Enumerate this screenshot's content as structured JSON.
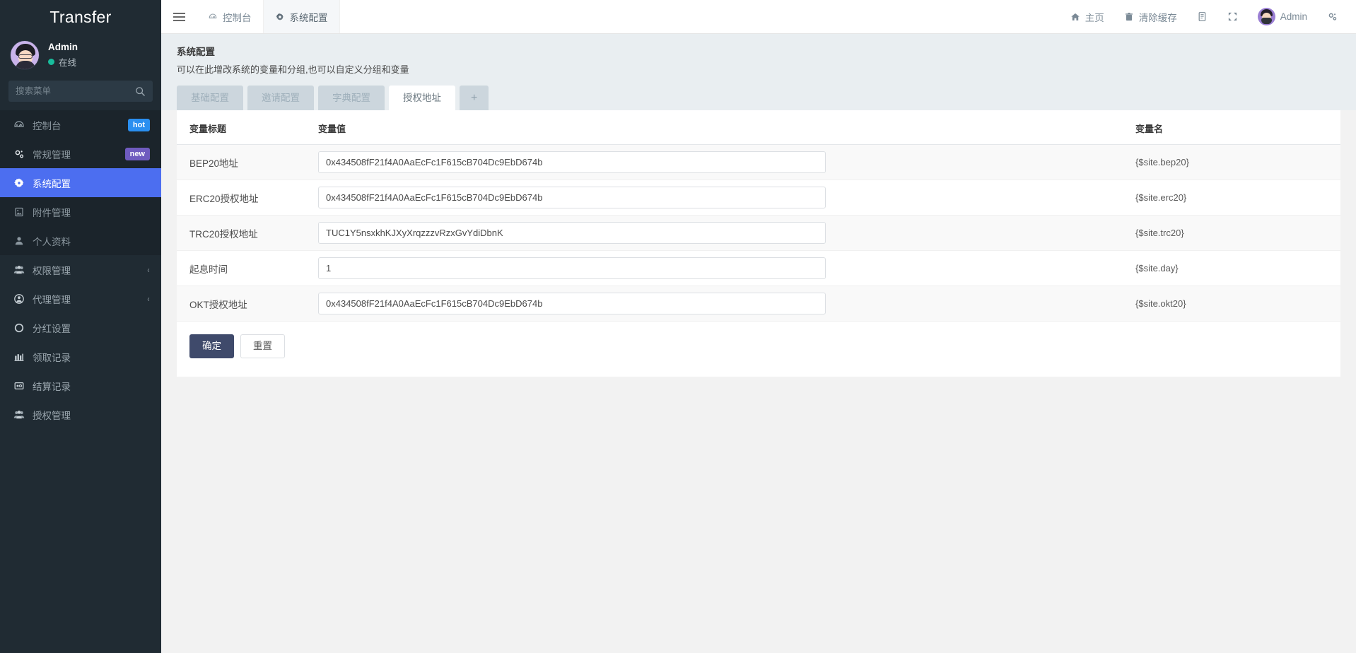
{
  "sidebar": {
    "brand": "Transfer",
    "user": {
      "name": "Admin",
      "status": "在线"
    },
    "search": {
      "placeholder": "搜索菜单",
      "value": ""
    },
    "items": [
      {
        "label": "控制台",
        "icon": "dashboard-icon",
        "badge": "hot",
        "badge_type": "hot",
        "state": "dim"
      },
      {
        "label": "常规管理",
        "icon": "cogs-icon",
        "badge": "new",
        "badge_type": "new",
        "state": "dim"
      },
      {
        "label": "系统配置",
        "icon": "gear-icon",
        "badge": "",
        "badge_type": "",
        "state": "active"
      },
      {
        "label": "附件管理",
        "icon": "image-file-icon",
        "badge": "",
        "badge_type": "",
        "state": "dim"
      },
      {
        "label": "个人资料",
        "icon": "user-icon",
        "badge": "",
        "badge_type": "",
        "state": "dim"
      },
      {
        "label": "权限管理",
        "icon": "users-group-icon",
        "badge": "",
        "badge_type": "",
        "state": "normal",
        "chevron": "‹"
      },
      {
        "label": "代理管理",
        "icon": "user-circle-icon",
        "badge": "",
        "badge_type": "",
        "state": "normal",
        "chevron": "‹"
      },
      {
        "label": "分红设置",
        "icon": "circle-icon",
        "badge": "",
        "badge_type": "",
        "state": "normal"
      },
      {
        "label": "领取记录",
        "icon": "chart-icon",
        "badge": "",
        "badge_type": "",
        "state": "normal"
      },
      {
        "label": "结算记录",
        "icon": "card-icon",
        "badge": "",
        "badge_type": "",
        "state": "normal"
      },
      {
        "label": "授权管理",
        "icon": "users-group-icon",
        "badge": "",
        "badge_type": "",
        "state": "normal"
      }
    ]
  },
  "topbar": {
    "menu_toggle": "menu-icon",
    "tabs": [
      {
        "label": "控制台",
        "icon": "dashboard-icon",
        "selected": false
      },
      {
        "label": "系统配置",
        "icon": "gear-icon",
        "selected": true
      }
    ],
    "right_items": [
      {
        "label": "主页",
        "icon": "home-icon"
      },
      {
        "label": "清除缓存",
        "icon": "trash-icon"
      },
      {
        "label": "",
        "icon": "note-icon"
      },
      {
        "label": "",
        "icon": "fullscreen-icon"
      },
      {
        "label": "Admin",
        "icon": "avatar"
      },
      {
        "label": "",
        "icon": "settings-gear-icon"
      }
    ]
  },
  "panel": {
    "title": "系统配置",
    "subtitle": "可以在此增改系统的变量和分组,也可以自定义分组和变量",
    "tabs": [
      {
        "label": "基础配置",
        "active": false
      },
      {
        "label": "邀请配置",
        "active": false
      },
      {
        "label": "字典配置",
        "active": false
      },
      {
        "label": "授权地址",
        "active": true
      },
      {
        "label": "+",
        "active": false,
        "is_add": true
      }
    ]
  },
  "table": {
    "headers": {
      "title": "变量标题",
      "value": "变量值",
      "name": "变量名"
    },
    "rows": [
      {
        "title": "BEP20地址",
        "value": "0x434508fF21f4A0AaEcFc1F615cB704Dc9EbD674b",
        "name": "{$site.bep20}"
      },
      {
        "title": "ERC20授权地址",
        "value": "0x434508fF21f4A0AaEcFc1F615cB704Dc9EbD674b",
        "name": "{$site.erc20}"
      },
      {
        "title": "TRC20授权地址",
        "value": "TUC1Y5nsxkhKJXyXrqzzzvRzxGvYdiDbnK",
        "name": "{$site.trc20}"
      },
      {
        "title": "起息时间",
        "value": "1",
        "name": "{$site.day}"
      },
      {
        "title": "OKT授权地址",
        "value": "0x434508fF21f4A0AaEcFc1F615cB704Dc9EbD674b",
        "name": "{$site.okt20}"
      }
    ]
  },
  "actions": {
    "submit": "确定",
    "reset": "重置"
  },
  "colors": {
    "sidebar_bg": "#202b33",
    "active_menu": "#4c6ef0",
    "badge_hot": "#2a8ff0",
    "badge_new": "#6f5bbf",
    "primary_button": "#3f4a6b",
    "panel_bg": "#e9eef1",
    "online_dot": "#18bc9c"
  }
}
